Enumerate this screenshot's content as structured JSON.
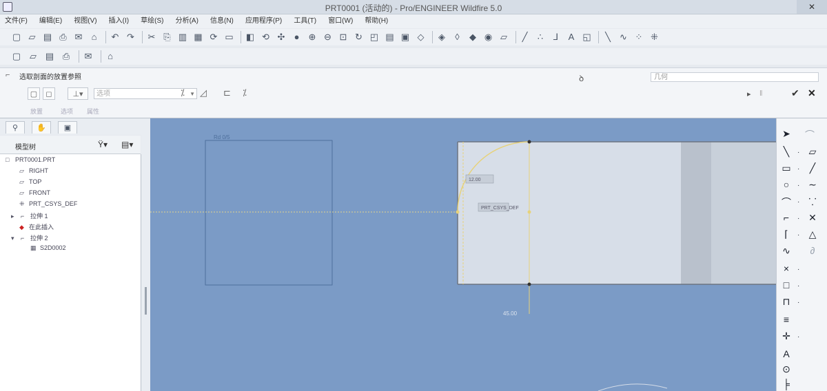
{
  "window": {
    "title": "PRT0001 (活动的) - Pro/ENGINEER Wildfire 5.0",
    "close_glyph": "✕"
  },
  "menu": [
    "文件(F)",
    "编辑(E)",
    "视图(V)",
    "插入(I)",
    "草绘(S)",
    "分析(A)",
    "信息(N)",
    "应用程序(P)",
    "工具(T)",
    "窗口(W)",
    "帮助(H)"
  ],
  "toolbar_row1_icons": [
    "new-icon",
    "open-icon",
    "save-icon",
    "print-icon",
    "send-icon",
    "mail-icon",
    "undo-icon",
    "redo-icon",
    "cut-icon",
    "copy-icon",
    "paste-icon",
    "paste-special-icon",
    "regenerate-icon",
    "select-box-icon",
    "repaint-icon",
    "orient-icon",
    "spin-center-icon",
    "shading-icon",
    "zoom-in-icon",
    "zoom-out-icon",
    "refit-icon",
    "reorient-icon",
    "saved-views-icon",
    "layers-icon",
    "view-manager-icon",
    "wireframe-icon",
    "hidden-line-icon",
    "no-hidden-icon",
    "shaded-icon",
    "enhanced-realism-icon",
    "datum-planes-icon",
    "datum-axes-icon",
    "datum-points-icon",
    "csys-icon",
    "annotations-icon",
    "plane-tool-icon",
    "axis-tool-icon",
    "curve-tool-icon",
    "point-tool-icon",
    "csys-tool-icon"
  ],
  "toolbar_row2_icons": [
    "sketch-mode-1-icon",
    "sketch-mode-2-icon",
    "sketch-mode-3-icon",
    "sketch-mode-4-icon",
    "sketch-setup-icon",
    "context-help-icon"
  ],
  "dashboard": {
    "message": "选取剖面的放置参照",
    "filter_placeholder": "几何",
    "combo_value": "选项",
    "labels": [
      "放置",
      "选项",
      "属性"
    ],
    "ok_glyph": "✔",
    "cancel_glyph": "✕",
    "pause_glyph": "‖",
    "play_glyph": "▸"
  },
  "tree": {
    "header_label": "模型树",
    "nodes": [
      {
        "label": "PRT0001.PRT",
        "icon": "part-icon"
      },
      {
        "label": "RIGHT",
        "icon": "datum-plane-icon"
      },
      {
        "label": "TOP",
        "icon": "datum-plane-icon"
      },
      {
        "label": "FRONT",
        "icon": "datum-plane-icon"
      },
      {
        "label": "PRT_CSYS_DEF",
        "icon": "csys-icon"
      },
      {
        "label": "拉伸 1",
        "icon": "extrude-icon"
      },
      {
        "label": "在此插入",
        "icon": "insert-here-icon"
      },
      {
        "label": "拉伸 2",
        "icon": "extrude-icon"
      },
      {
        "label": "S2D0002",
        "icon": "section-icon"
      }
    ]
  },
  "sketch": {
    "dim_labels": [
      "Rd 0/5",
      "PRT_CSYS_DEF",
      "45.00",
      "12.00"
    ]
  },
  "colors": {
    "canvas": "#7b9bc6",
    "part_fill": "#d7dee8",
    "sketch_yellow": "#e7d27a"
  }
}
